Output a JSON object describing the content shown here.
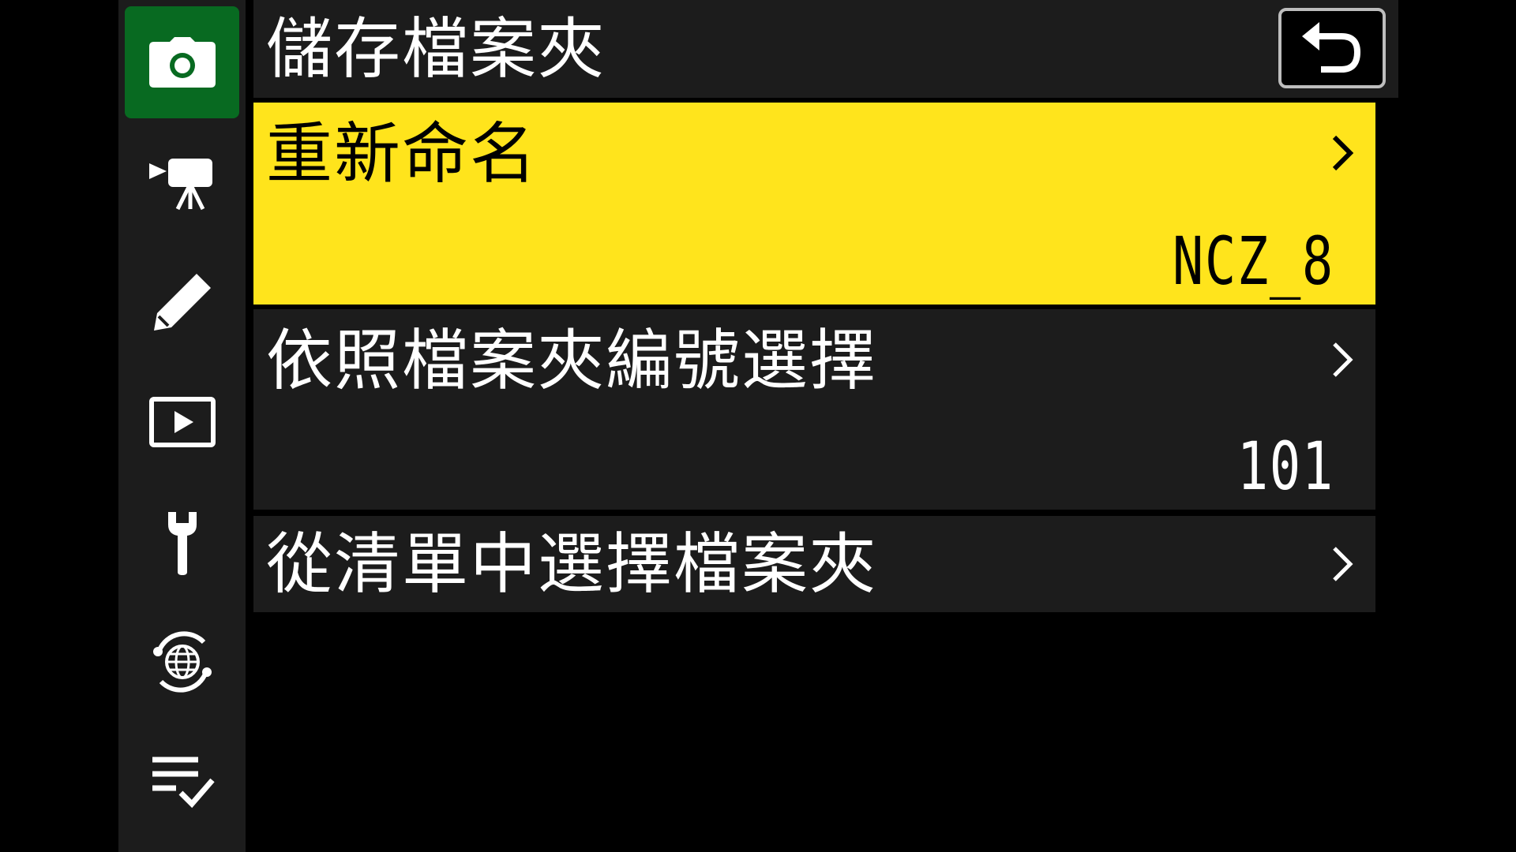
{
  "sidebar": {
    "tabs": [
      {
        "name": "camera-icon",
        "active": true
      },
      {
        "name": "movie-camera-icon",
        "active": false
      },
      {
        "name": "pencil-icon",
        "active": false
      },
      {
        "name": "playback-icon",
        "active": false
      },
      {
        "name": "wrench-icon",
        "active": false
      },
      {
        "name": "network-globe-icon",
        "active": false
      },
      {
        "name": "my-menu-checklist-icon",
        "active": false
      }
    ],
    "active_color": "#086a21"
  },
  "header": {
    "title": "儲存檔案夾",
    "back_icon": "return-arrow-icon"
  },
  "menu": {
    "items": [
      {
        "label": "重新命名",
        "value": "NCZ_8",
        "selected": true
      },
      {
        "label": "依照檔案夾編號選擇",
        "value": "101",
        "selected": false
      },
      {
        "label": "從清單中選擇檔案夾",
        "selected": false
      }
    ],
    "chevron_icon": "chevron-right-icon"
  },
  "colors": {
    "selected_background": "#ffe41c",
    "item_background": "#1c1c1c",
    "screen_background": "#000000"
  }
}
